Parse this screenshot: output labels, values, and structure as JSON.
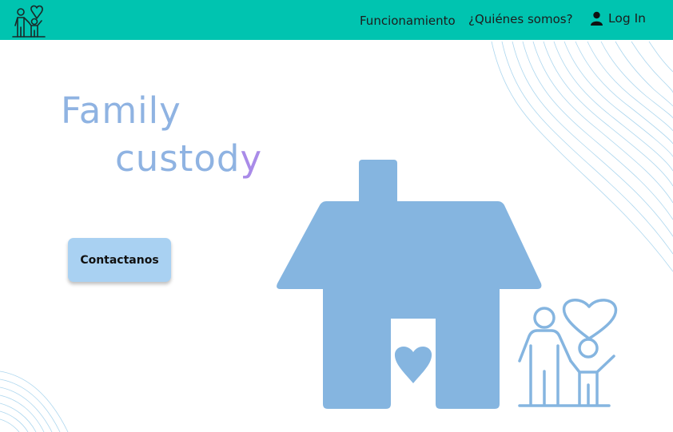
{
  "nav": {
    "links": [
      {
        "label": "Funcionamiento"
      },
      {
        "label": "¿Quiénes somos?"
      }
    ],
    "login_label": "Log In"
  },
  "hero": {
    "title_line1": "Family",
    "title_line2": "custod",
    "title_last_letter": "y",
    "cta_label": "Contactanos"
  },
  "icons": {
    "logo": "family-heart-icon",
    "login": "user-icon",
    "illustration": "house-heart-icon",
    "family": "parent-child-heart-icon"
  },
  "colors": {
    "navbar": "#00c4b0",
    "title": "#8fb3e2",
    "title_accent": "#a98be8",
    "button": "#a9d1f2",
    "house": "#85b5e0"
  }
}
